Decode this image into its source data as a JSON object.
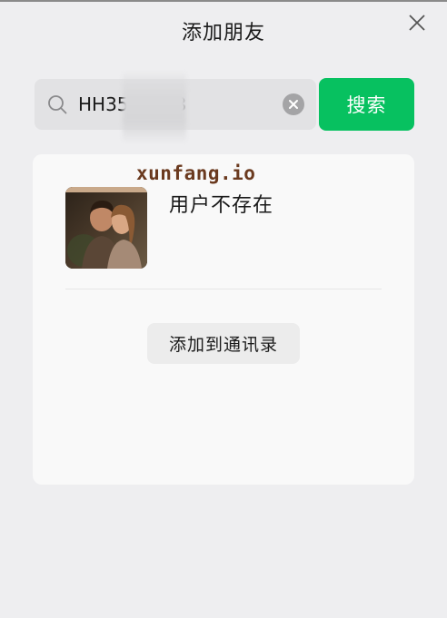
{
  "window": {
    "title": "添加朋友",
    "close_icon": "close-icon"
  },
  "search": {
    "query": "HH35      78",
    "search_icon": "search-icon",
    "clear_icon": "clear-circle-icon",
    "button_label": "搜索",
    "button_color": "#07c160"
  },
  "result": {
    "watermark": "xunfang.io",
    "avatar": "couple-photo",
    "status": "用户不存在",
    "add_button_label": "添加到通讯录"
  },
  "colors": {
    "background": "#eeeef0",
    "card": "#f9f9f9",
    "accent": "#07c160"
  }
}
